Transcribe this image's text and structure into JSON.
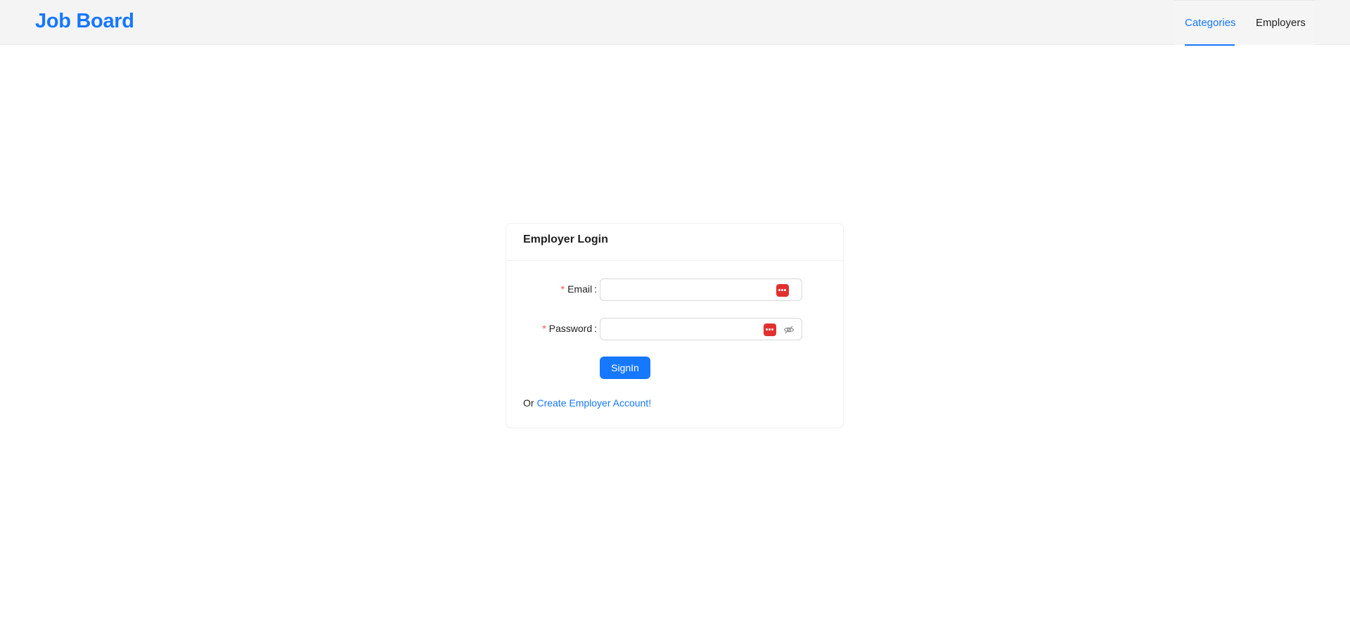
{
  "header": {
    "brand": "Job Board",
    "nav": [
      {
        "label": "Categories",
        "active": true
      },
      {
        "label": "Employers",
        "active": false
      }
    ]
  },
  "login": {
    "title": "Employer Login",
    "email_label": "Email",
    "password_label": "Password",
    "email_value": "",
    "password_value": "",
    "submit_label": "SignIn",
    "alt_prefix": "Or",
    "create_link": "Create Employer Account!"
  },
  "icons": {
    "password_manager": "password-manager-icon",
    "toggle_visibility": "eye-invisible-icon"
  },
  "colors": {
    "primary": "#1677ff",
    "required": "#ff4d4f",
    "password_manager": "#e0312f"
  }
}
